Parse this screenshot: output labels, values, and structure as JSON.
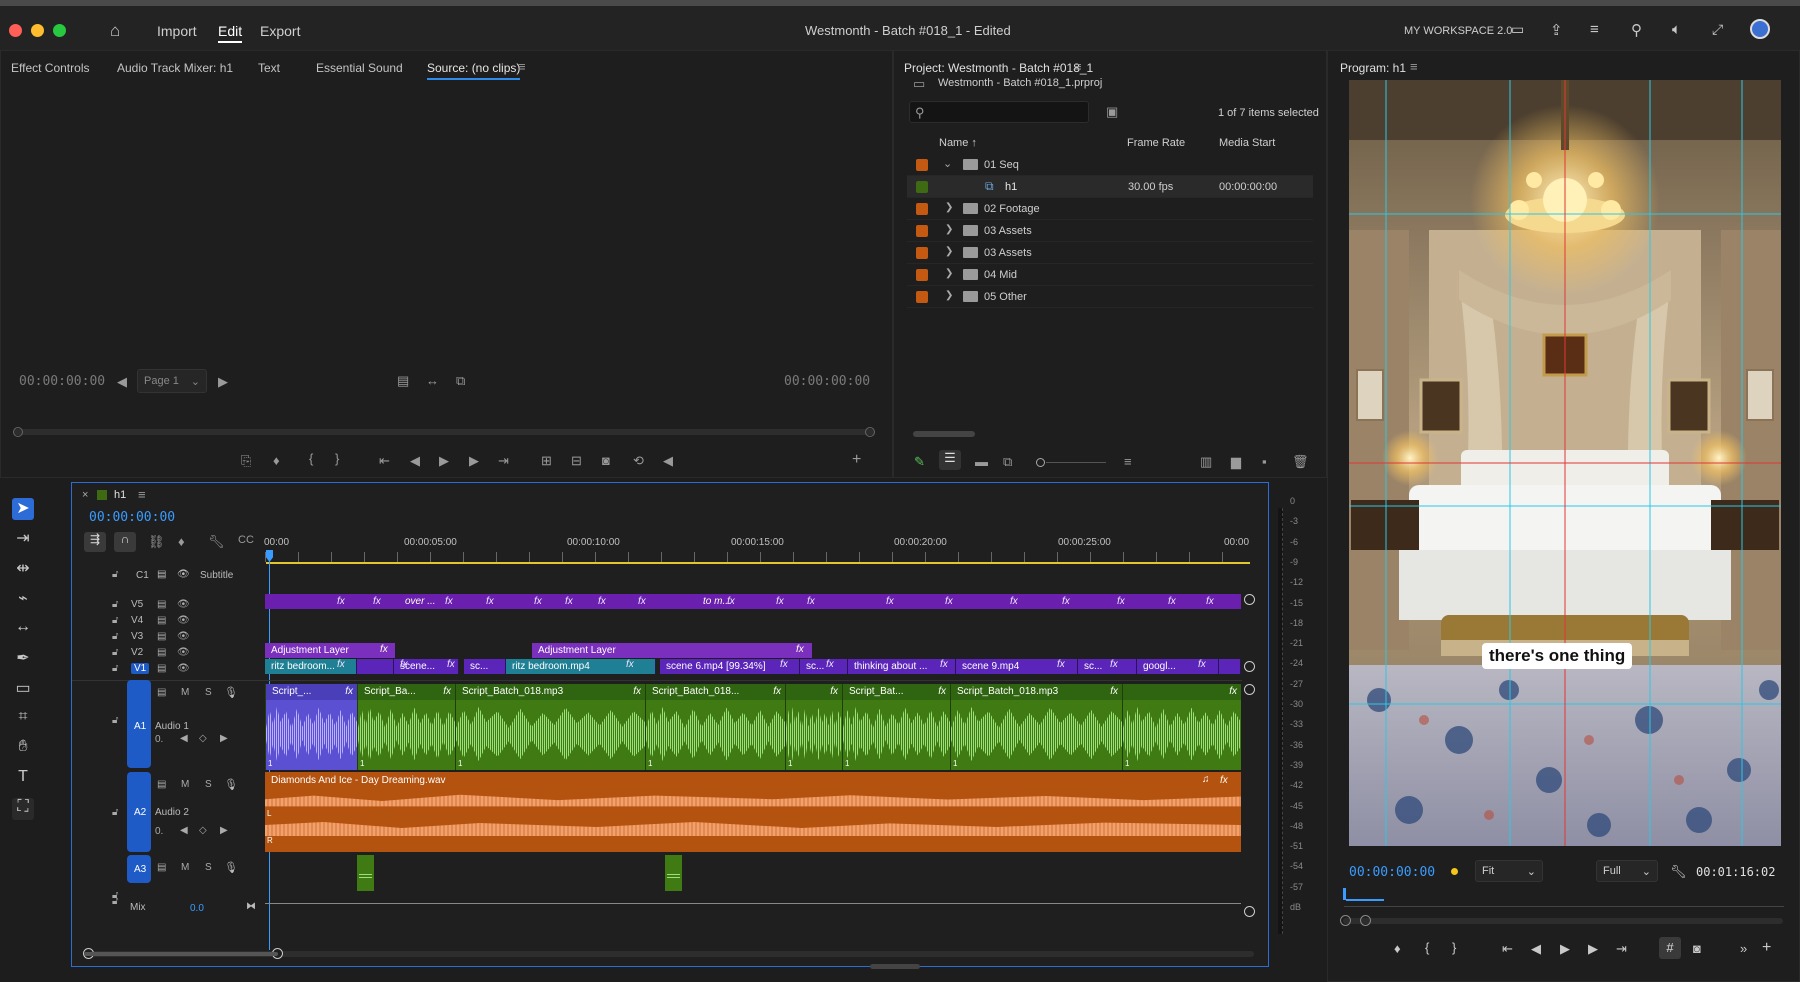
{
  "window": {
    "title": "Westmonth - Batch #018_1 - Edited",
    "nav": [
      "Import",
      "Edit",
      "Export"
    ],
    "workspace": "MY WORKSPACE 2.0"
  },
  "source_panel": {
    "tabs": [
      "Effect Controls",
      "Audio Track Mixer: h1",
      "Text",
      "Essential Sound",
      "Source: (no clips)"
    ],
    "timecode_left": "00:00:00:00",
    "timecode_right": "00:00:00:00",
    "page_select": "Page 1"
  },
  "project_panel": {
    "title": "Project: Westmonth - Batch #018_1",
    "file": "Westmonth - Batch #018_1.prproj",
    "search_placeholder": "",
    "selection_status": "1 of 7 items selected",
    "columns": [
      "Name",
      "Frame Rate",
      "Media Start"
    ],
    "rows": [
      {
        "name": "01 Seq",
        "type": "folder",
        "expanded": true,
        "color": "#c45a12",
        "frame_rate": "",
        "media_start": ""
      },
      {
        "name": "h1",
        "type": "sequence",
        "expanded": false,
        "color": "#3d6a12",
        "frame_rate": "30.00 fps",
        "media_start": "00:00:00:00"
      },
      {
        "name": "02 Footage",
        "type": "folder",
        "expanded": false,
        "color": "#c45a12",
        "frame_rate": "",
        "media_start": ""
      },
      {
        "name": "03 Assets",
        "type": "folder",
        "expanded": false,
        "color": "#c45a12",
        "frame_rate": "",
        "media_start": ""
      },
      {
        "name": "03 Assets",
        "type": "folder",
        "expanded": false,
        "color": "#c45a12",
        "frame_rate": "",
        "media_start": ""
      },
      {
        "name": "04 Mid",
        "type": "folder",
        "expanded": false,
        "color": "#c45a12",
        "frame_rate": "",
        "media_start": ""
      },
      {
        "name": "05 Other",
        "type": "folder",
        "expanded": false,
        "color": "#c45a12",
        "frame_rate": "",
        "media_start": ""
      }
    ]
  },
  "program_panel": {
    "title": "Program: h1",
    "caption": "there's one thing",
    "timecode": "00:00:00:00",
    "fit": "Fit",
    "quality": "Full",
    "duration": "00:01:16:02"
  },
  "timeline": {
    "sequence": "h1",
    "timecode": "00:00:00:00",
    "ruler": [
      "00:00",
      "00:00:05:00",
      "00:00:10:00",
      "00:00:15:00",
      "00:00:20:00",
      "00:00:25:00",
      "00:00"
    ],
    "subtitle_track": {
      "id": "C1",
      "name": "Subtitle"
    },
    "video_tracks": [
      "V5",
      "V4",
      "V3",
      "V2",
      "V1"
    ],
    "audio_tracks": [
      {
        "id": "A1",
        "name": "Audio 1"
      },
      {
        "id": "A2",
        "name": "Audio 2"
      },
      {
        "id": "A3",
        "name": ""
      }
    ],
    "mix": {
      "label": "Mix",
      "value": "0.0"
    },
    "track_buttons": {
      "m": "M",
      "s": "S",
      "zero": "0."
    },
    "fx_label": "fx",
    "v5_labels": {
      "over": "over ...",
      "tom": "to m..."
    },
    "v2_clips": [
      "Adjustment Layer",
      "Adjustment Layer"
    ],
    "v1_clips": [
      "ritz bedroom...",
      "scene...",
      "sc...",
      "ritz bedroom.mp4",
      "scene 6.mp4 [99.34%]",
      "sc...",
      "thinking about ...",
      "scene 9.mp4",
      "sc...",
      "googl..."
    ],
    "a1_clips": [
      "Script_...",
      "Script_Ba...",
      "Script_Batch_018.mp3",
      "Script_Batch_018...",
      "",
      "Script_Bat...",
      "Script_Batch_018.mp3",
      ""
    ],
    "a2_clip": "Diamonds And Ice - Day Dreaming.wav",
    "a2_channels": [
      "L",
      "R"
    ],
    "clip_marker": "1"
  },
  "meter_scale": [
    "0",
    "-3",
    "-6",
    "-9",
    "-12",
    "-15",
    "-18",
    "-21",
    "-24",
    "-27",
    "-30",
    "-33",
    "-36",
    "-39",
    "-42",
    "-45",
    "-48",
    "-51",
    "-54",
    "-57",
    "dB"
  ],
  "colors": {
    "accent": "#2d8ceb",
    "purple_clip": "#6a1fae",
    "audio_green": "#3f7a13",
    "audio_orange": "#b4520f",
    "timeline_blue": "#3a9cff"
  }
}
